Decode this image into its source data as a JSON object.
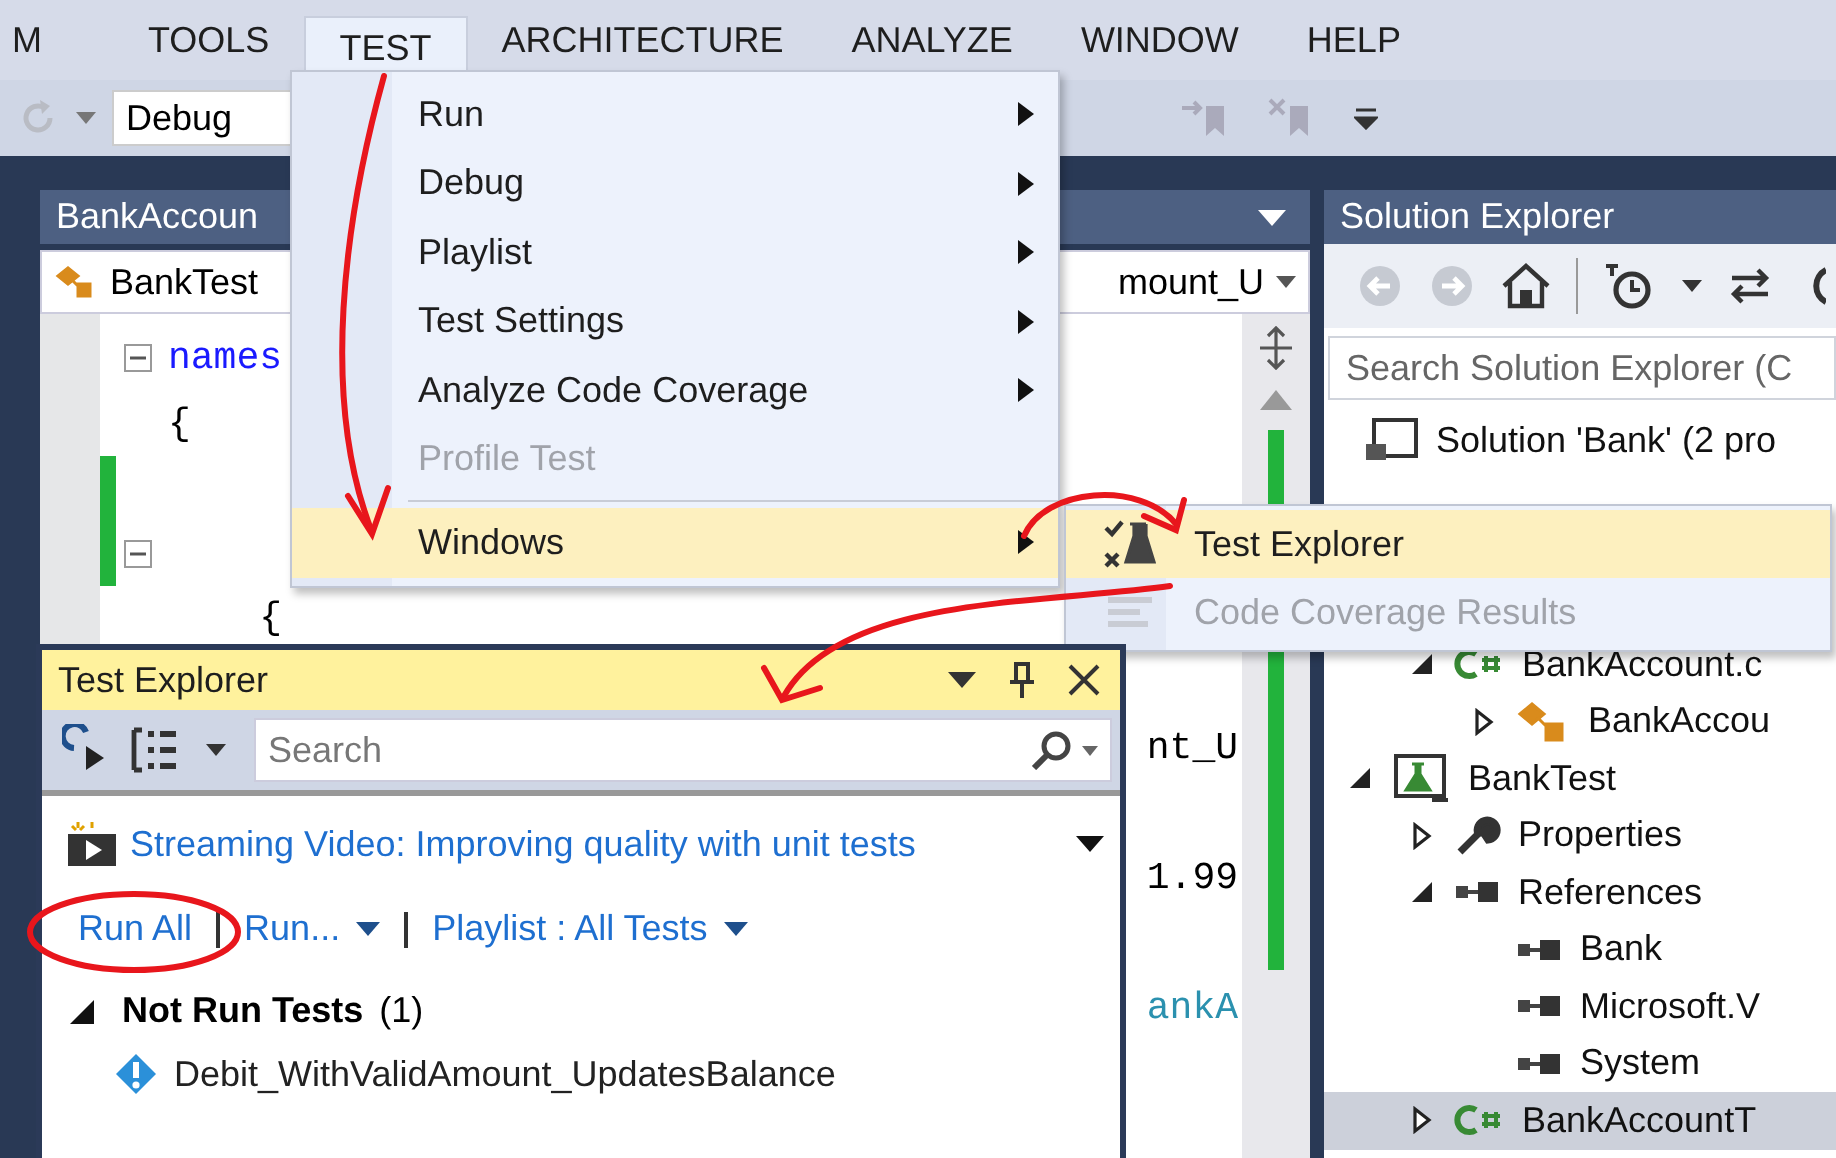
{
  "menu_bar": [
    {
      "label": "M",
      "selected": false
    },
    {
      "label": "TOOLS",
      "selected": false
    },
    {
      "label": "TEST",
      "selected": true
    },
    {
      "label": "ARCHITECTURE",
      "selected": false
    },
    {
      "label": "ANALYZE",
      "selected": false
    },
    {
      "label": "WINDOW",
      "selected": false
    },
    {
      "label": "HELP",
      "selected": false
    }
  ],
  "toolbar": {
    "configuration": "Debug"
  },
  "editor": {
    "tab_title": "BankAccoun",
    "type_dropdown": "BankTest",
    "member_dropdown": "mount_U",
    "lines": [
      {
        "kind": "keyword",
        "text": "names",
        "fold": true,
        "changed": false
      },
      {
        "kind": "plain",
        "text": "{",
        "fold": false,
        "changed": false
      },
      {
        "kind": "blank",
        "fold": false,
        "changed": true
      },
      {
        "kind": "blank",
        "fold": true,
        "changed": true
      },
      {
        "kind": "plain",
        "text": "    {",
        "fold": false,
        "changed": false
      },
      {
        "kind": "blank"
      },
      {
        "kind": "blank",
        "tail": {
          "text": "nt_U",
          "kind": "plain"
        }
      },
      {
        "kind": "blank"
      },
      {
        "kind": "blank",
        "tail": {
          "text": "1.99",
          "kind": "plain"
        }
      },
      {
        "kind": "blank"
      },
      {
        "kind": "blank",
        "tail": {
          "text": "ankA",
          "kind": "type"
        }
      }
    ]
  },
  "solution_explorer": {
    "title": "Solution Explorer",
    "search": {
      "placeholder": "Search Solution Explorer (C"
    },
    "tree": [
      {
        "label": "Solution 'Bank' (2 pro",
        "kind": "solution",
        "bold": false,
        "selected": false,
        "children": [
          {
            "children": [
              {
                "label": "BankAccount.c",
                "kind": "csharp-file",
                "bold": false,
                "selected": false,
                "expanded": true,
                "children": [
                  {
                    "label": "BankAccou",
                    "kind": "class",
                    "bold": false,
                    "selected": false,
                    "expanded": false
                  }
                ]
              }
            ]
          },
          {
            "label": "BankTest",
            "kind": "test-project",
            "bold": false,
            "selected": false,
            "expanded": true,
            "children": [
              {
                "label": "Properties",
                "kind": "properties",
                "bold": false,
                "selected": false,
                "expanded": false
              },
              {
                "label": "References",
                "kind": "references",
                "bold": false,
                "selected": false,
                "expanded": true,
                "children": [
                  {
                    "label": "Bank",
                    "kind": "reference",
                    "bold": false,
                    "selected": false
                  },
                  {
                    "label": "Microsoft.V",
                    "kind": "reference",
                    "bold": false,
                    "selected": false
                  },
                  {
                    "label": "System",
                    "kind": "reference",
                    "bold": false,
                    "selected": false
                  }
                ]
              },
              {
                "label": "BankAccountT",
                "kind": "csharp-file",
                "bold": false,
                "selected": true,
                "expanded": false
              }
            ]
          }
        ]
      }
    ]
  },
  "test_menu": {
    "items": [
      {
        "kind": "item",
        "label": "Run",
        "submenu": true,
        "disabled": false,
        "selected": false
      },
      {
        "kind": "item",
        "label": "Debug",
        "submenu": true,
        "disabled": false,
        "selected": false
      },
      {
        "kind": "item",
        "label": "Playlist",
        "submenu": true,
        "disabled": false,
        "selected": false
      },
      {
        "kind": "item",
        "label": "Test Settings",
        "submenu": true,
        "disabled": false,
        "selected": false
      },
      {
        "kind": "item",
        "label": "Analyze Code Coverage",
        "submenu": true,
        "disabled": false,
        "selected": false
      },
      {
        "kind": "item",
        "label": "Profile Test",
        "submenu": false,
        "disabled": true,
        "selected": false
      },
      {
        "kind": "separator"
      },
      {
        "kind": "item",
        "label": "Windows",
        "submenu": true,
        "disabled": false,
        "selected": true
      }
    ]
  },
  "windows_submenu": {
    "items": [
      {
        "label": "Test Explorer",
        "kind": "test-explorer",
        "disabled": false,
        "selected": true
      },
      {
        "label": "Code Coverage Results",
        "kind": "coverage",
        "disabled": true,
        "selected": false
      }
    ]
  },
  "test_explorer": {
    "title": "Test Explorer",
    "search": {
      "placeholder": "Search"
    },
    "video_link": "Streaming Video: Improving quality with unit tests",
    "actions": [
      {
        "label": "Run All",
        "kind": "link"
      },
      {
        "label": "Run...",
        "kind": "menu"
      },
      {
        "label": "Playlist : All Tests",
        "kind": "menu"
      }
    ],
    "groups": [
      {
        "label": "Not Run Tests",
        "count": "(1)",
        "expanded": true,
        "tests": [
          {
            "name": "Debit_WithValidAmount_UpdatesBalance"
          }
        ]
      }
    ]
  }
}
